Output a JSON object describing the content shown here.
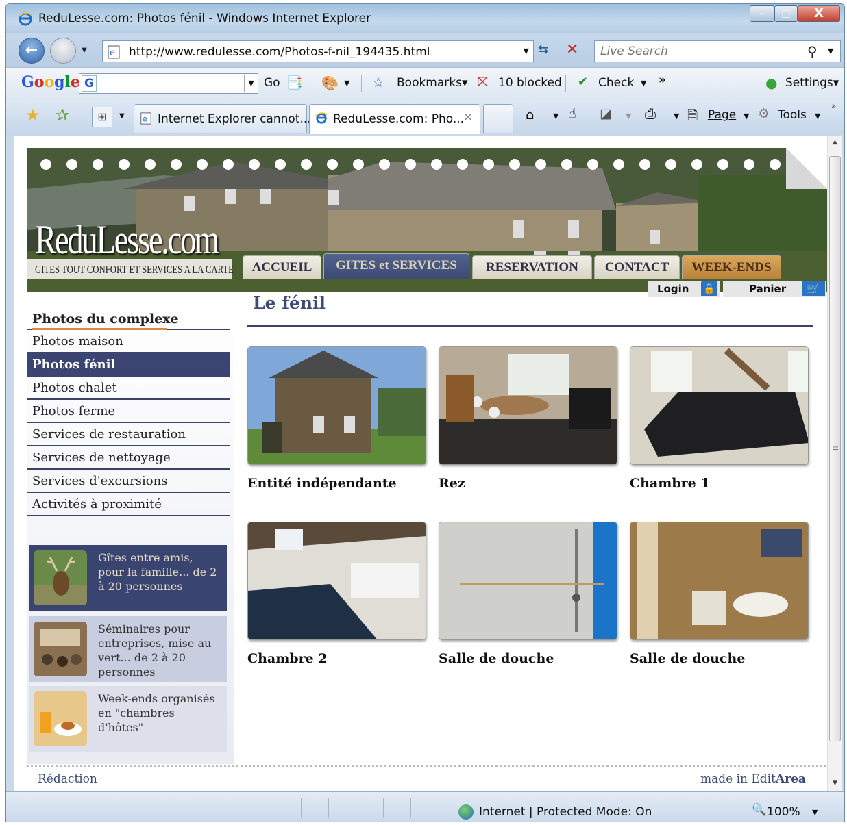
{
  "window": {
    "title": "ReduLesse.com: Photos fénil - Windows Internet Explorer",
    "minimize_label": "–",
    "maximize_label": "□",
    "close_label": "X"
  },
  "addressbar": {
    "url": "http://www.redulesse.com/Photos-f-nil_194435.html",
    "search_placeholder": "Live Search"
  },
  "google_toolbar": {
    "logo": "Google",
    "go_label": "Go",
    "bookmarks_label": "Bookmarks▾",
    "blocked_label": "10 blocked",
    "check_label": "Check",
    "more_label": "»",
    "settings_label": "Settings▾"
  },
  "tabs": [
    {
      "label": "Internet Explorer cannot..."
    },
    {
      "label": "ReduLesse.com: Pho...",
      "close": "✕"
    }
  ],
  "commands": {
    "page_label": "Page",
    "tools_label": "Tools",
    "more_label": "»"
  },
  "site": {
    "logo": "ReduLesse.com",
    "tagline": "GITES TOUT CONFORT ET SERVICES A LA CARTE",
    "nav": [
      "ACCUEIL",
      "GITES et SERVICES",
      "RESERVATION",
      "CONTACT",
      "WEEK-ENDS"
    ],
    "login_label": "Login",
    "cart_label": "Panier"
  },
  "sidebar": {
    "title": "Photos du complexe",
    "items": [
      {
        "label": "Photos maison"
      },
      {
        "label": "Photos fénil",
        "active": true
      },
      {
        "label": "Photos chalet"
      },
      {
        "label": "Photos ferme"
      },
      {
        "label": "Services de restauration"
      },
      {
        "label": "Services de nettoyage"
      },
      {
        "label": "Services d'excursions"
      },
      {
        "label": "Activités à proximité"
      }
    ],
    "promos": [
      {
        "text": "Gîtes entre amis, pour la famille... de 2 à 20 personnes"
      },
      {
        "text": "Séminaires pour entreprises, mise au vert... de 2 à 20 personnes"
      },
      {
        "text": "Week-ends organisés en \"chambres d'hôtes\""
      }
    ]
  },
  "main": {
    "title": "Le fénil",
    "photos": [
      {
        "caption": "Entité indépendante"
      },
      {
        "caption": "Rez"
      },
      {
        "caption": "Chambre 1"
      },
      {
        "caption": "Chambre 2"
      },
      {
        "caption": "Salle de douche"
      },
      {
        "caption": "Salle de douche"
      }
    ]
  },
  "footer": {
    "left": "Rédaction",
    "right_prefix": "made in Edit",
    "right_bold": "Area"
  },
  "statusbar": {
    "zone": "Internet | Protected Mode: On",
    "zoom": "100%"
  },
  "colors": {
    "nav_active": "#3c4a73",
    "sidebar_active": "#3a4574",
    "accent": "#e0873a",
    "weekends_tab": "#c9953f"
  }
}
